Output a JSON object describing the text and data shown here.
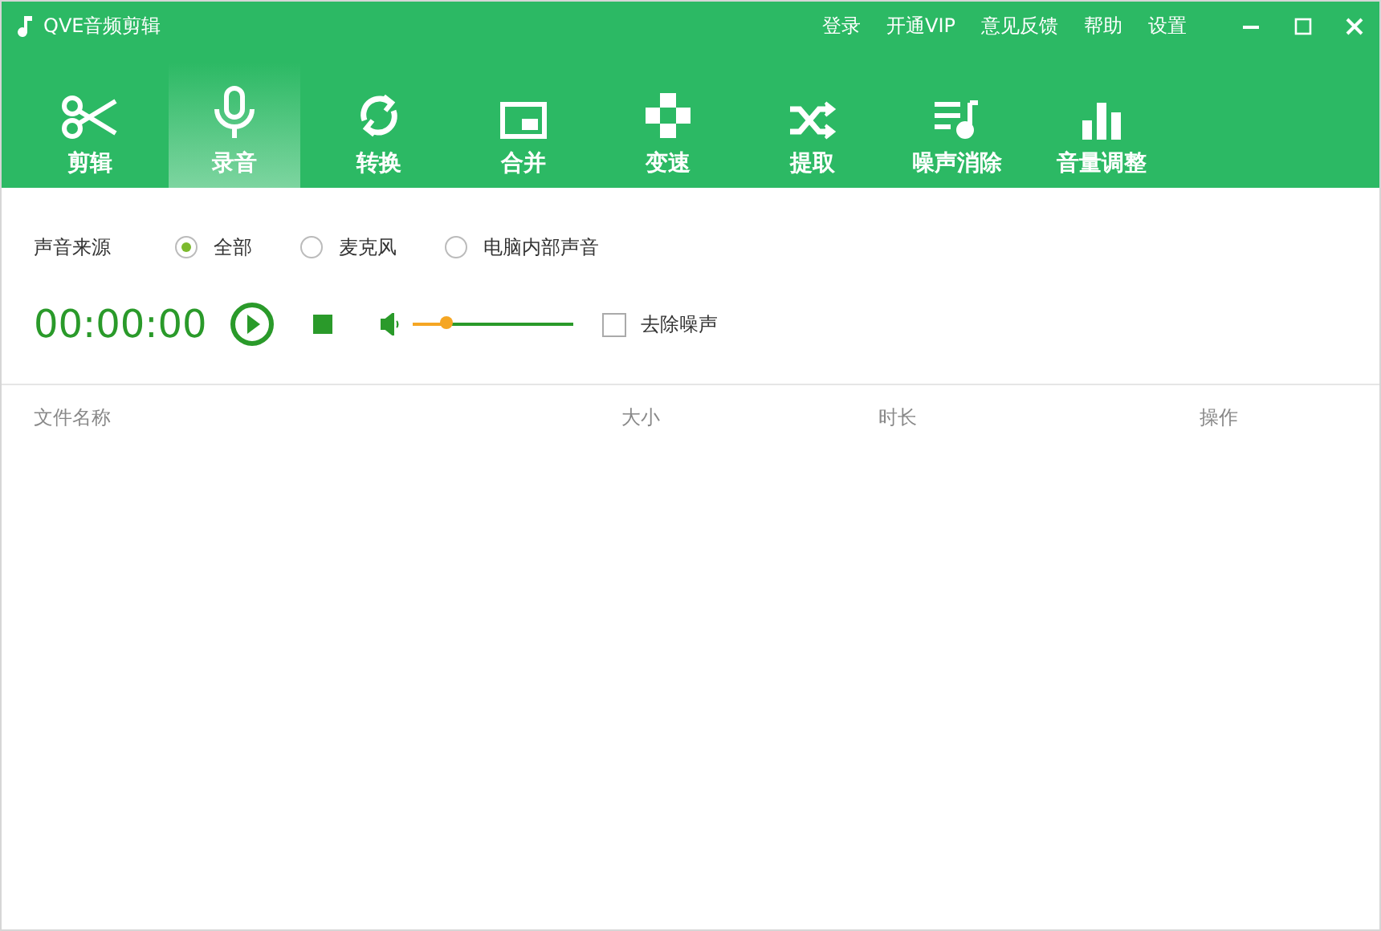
{
  "window": {
    "title": "QVE音频剪辑"
  },
  "top_links": [
    "登录",
    "开通VIP",
    "意见反馈",
    "帮助",
    "设置"
  ],
  "tabs": [
    {
      "label": "剪辑",
      "kind": "scissors",
      "selected": false
    },
    {
      "label": "录音",
      "kind": "mic",
      "selected": true
    },
    {
      "label": "转换",
      "kind": "cycle",
      "selected": false
    },
    {
      "label": "合并",
      "kind": "window",
      "selected": false
    },
    {
      "label": "变速",
      "kind": "dpad",
      "selected": false
    },
    {
      "label": "提取",
      "kind": "shuffle",
      "selected": false
    },
    {
      "label": "噪声消除",
      "kind": "playlist",
      "selected": false
    },
    {
      "label": "音量调整",
      "kind": "bars",
      "selected": false
    }
  ],
  "source": {
    "label": "声音来源",
    "options": [
      {
        "label": "全部",
        "selected": true
      },
      {
        "label": "麦克风",
        "selected": false
      },
      {
        "label": "电脑内部声音",
        "selected": false
      }
    ]
  },
  "recorder": {
    "time": "00:00:00",
    "volume": {
      "level": 0.21
    },
    "denoise": {
      "label": "去除噪声",
      "checked": false
    }
  },
  "table": {
    "columns": [
      "文件名称",
      "大小",
      "时长",
      "操作"
    ]
  }
}
